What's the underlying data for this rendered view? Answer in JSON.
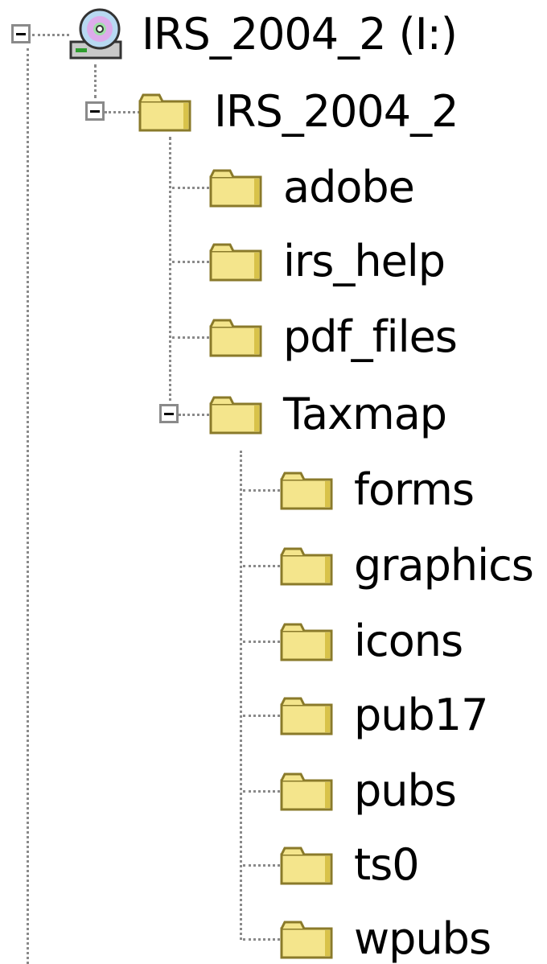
{
  "tree": {
    "drive": {
      "label": "IRS_2004_2 (I:)",
      "icon": "cd-drive-icon"
    },
    "root_folder": {
      "label": "IRS_2004_2",
      "icon": "folder-icon"
    },
    "root_children": [
      {
        "label": "adobe"
      },
      {
        "label": "irs_help"
      },
      {
        "label": "pdf_files"
      },
      {
        "label": "Taxmap"
      }
    ],
    "taxmap_children": [
      {
        "label": "forms"
      },
      {
        "label": "graphics"
      },
      {
        "label": "icons"
      },
      {
        "label": "pub17"
      },
      {
        "label": "pubs"
      },
      {
        "label": "ts0"
      },
      {
        "label": "wpubs"
      }
    ],
    "colors": {
      "folder_fill": "#f4e58c",
      "folder_dark": "#8a7a2a",
      "connector": "#8a8a8a"
    }
  }
}
